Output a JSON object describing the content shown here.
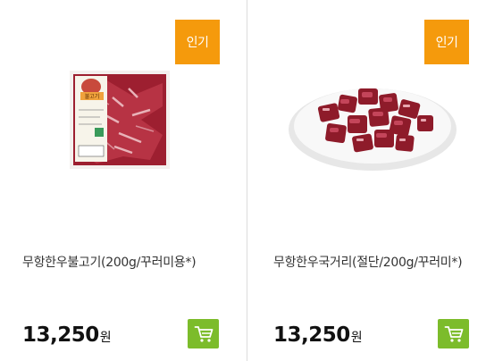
{
  "products": [
    {
      "badge": "인기",
      "image_label": "불고기",
      "name": "무항한우불고기(200g/꾸러미용*)",
      "price": "13,250",
      "price_unit": "원"
    },
    {
      "badge": "인기",
      "name": "무항한우국거리(절단/200g/꾸러미*)",
      "price": "13,250",
      "price_unit": "원"
    }
  ],
  "colors": {
    "badge": "#f59a0c",
    "cart": "#7cbc2b"
  },
  "icons": {
    "cart": "shopping-cart-icon"
  }
}
